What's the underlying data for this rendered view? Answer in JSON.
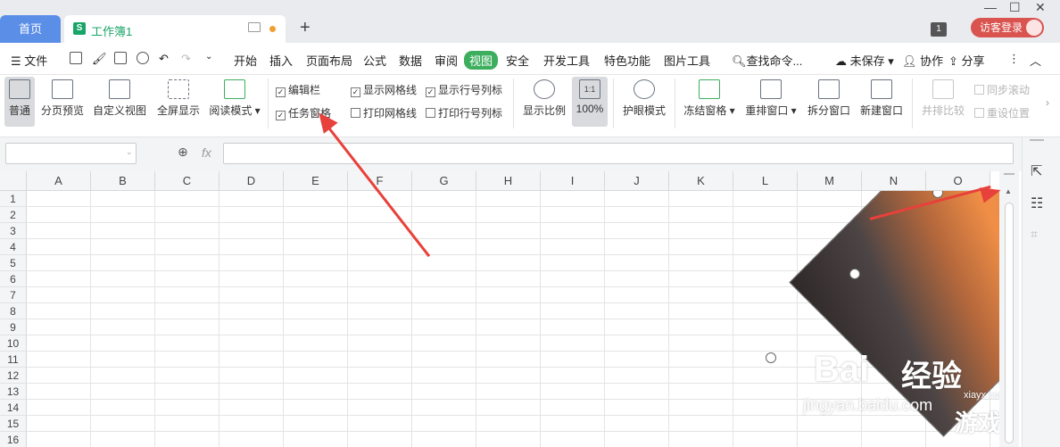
{
  "tabs": {
    "home": "首页",
    "doc_title": "工作簿1",
    "doc_icon": "S"
  },
  "titlebar": {
    "window_badge": "1",
    "login_label": "访客登录"
  },
  "menu": {
    "file": "文件",
    "items": [
      "开始",
      "插入",
      "页面布局",
      "公式",
      "数据",
      "审阅",
      "视图",
      "安全",
      "开发工具",
      "特色功能",
      "图片工具"
    ],
    "active": "视图",
    "search": "查找命令...",
    "unsaved": "未保存",
    "collab": "协作",
    "share": "分享"
  },
  "ribbon": {
    "buttons": [
      "普通",
      "分页预览",
      "自定义视图",
      "全屏显示",
      "阅读模式"
    ],
    "checks": {
      "edit_bar": "编辑栏",
      "task_pane": "任务窗格",
      "show_gridlines": "显示网格线",
      "print_gridlines": "打印网格线",
      "show_headers": "显示行号列标",
      "print_headers": "打印行号列标"
    },
    "zoom_label": "显示比例",
    "zoom_value": "100%",
    "zoom_icon_text": "1:1",
    "eye_mode": "护眼模式",
    "freeze": "冻结窗格",
    "rearrange": "重排窗口",
    "split": "拆分窗口",
    "new_window": "新建窗口",
    "side_by_side": "并排比较",
    "sync_scroll": "同步滚动",
    "reset_pos": "重设位置"
  },
  "formula": {
    "fx": "fx",
    "name_box": "",
    "value": ""
  },
  "columns": [
    "A",
    "B",
    "C",
    "D",
    "E",
    "F",
    "G",
    "H",
    "I",
    "J",
    "K",
    "L",
    "M",
    "N",
    "O"
  ],
  "rows": [
    "1",
    "2",
    "3",
    "4",
    "5",
    "6",
    "7",
    "8",
    "9",
    "10",
    "11",
    "12",
    "13",
    "14",
    "15",
    "16"
  ],
  "watermark": {
    "baidu": "Bai",
    "jingyan": "经验",
    "url": "jingyan.baidu.com",
    "site": "xiayx.com",
    "brand": "游戏"
  },
  "colors": {
    "accent": "#3dae5e",
    "home_tab": "#5b8ee6",
    "login": "#d9534f",
    "arrow": "#e8403a"
  }
}
